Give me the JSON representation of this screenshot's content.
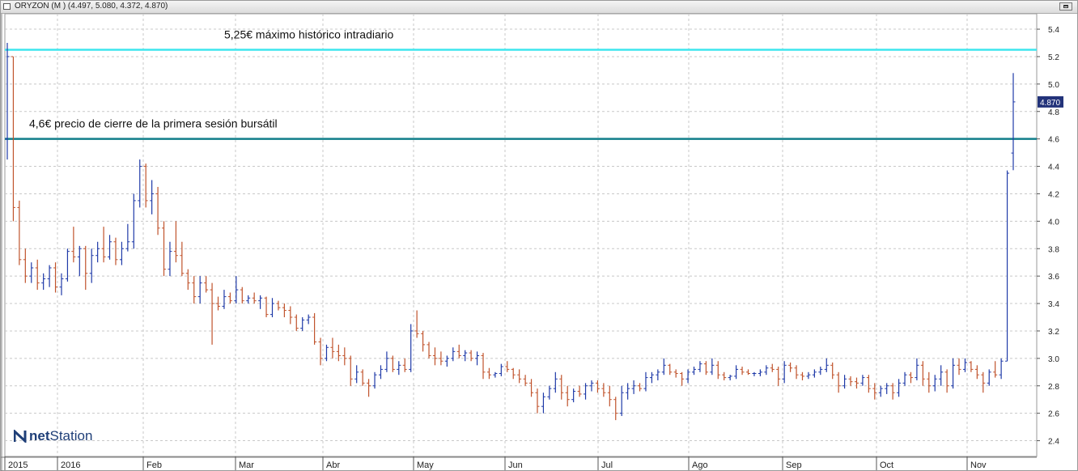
{
  "window": {
    "title": "ORYZON (M ) (4.497, 5.080, 4.372, 4.870)",
    "maximize_icon": "maximize-icon"
  },
  "logo": {
    "icon": "netstation-logo-icon",
    "text_prefix": "net",
    "text_main": "Station"
  },
  "chart_data": {
    "type": "ohlc",
    "grid": true,
    "ylim": [
      2.3,
      5.45
    ],
    "y_ticks": [
      2.4,
      2.6,
      2.8,
      3.0,
      3.2,
      3.4,
      3.6,
      3.8,
      4.0,
      4.2,
      4.4,
      4.6,
      4.8,
      5.0,
      5.2,
      5.4
    ],
    "x_labels": [
      "2015",
      "2016",
      "Feb",
      "Mar",
      "Abr",
      "May",
      "Jun",
      "Jul",
      "Ago",
      "Sep",
      "Oct",
      "Nov"
    ],
    "last_price": {
      "value": 4.87,
      "label": "4.870"
    },
    "colors": {
      "up": "#1f3aa8",
      "down": "#c0532c",
      "resistance": "#3ee6ee",
      "support": "#117e8a",
      "last_price_bg": "#23337a"
    },
    "hlines": [
      {
        "value": 5.25,
        "label": "5,25€ máximo histórico intradiario",
        "style": "resistance"
      },
      {
        "value": 4.6,
        "label": "4,6€ precio de cierre de la primera sesión bursátil",
        "style": "support"
      }
    ],
    "bars": [
      [
        4.6,
        5.3,
        4.45,
        5.2
      ],
      [
        5.2,
        5.2,
        4.0,
        4.1
      ],
      [
        4.1,
        4.15,
        3.68,
        3.72
      ],
      [
        3.72,
        3.8,
        3.55,
        3.6
      ],
      [
        3.6,
        3.7,
        3.55,
        3.66
      ],
      [
        3.66,
        3.72,
        3.5,
        3.55
      ],
      [
        3.55,
        3.62,
        3.5,
        3.58
      ],
      [
        3.58,
        3.68,
        3.52,
        3.66
      ],
      [
        3.66,
        3.7,
        3.48,
        3.52
      ],
      [
        3.52,
        3.62,
        3.46,
        3.58
      ],
      [
        3.58,
        3.8,
        3.56,
        3.78
      ],
      [
        3.78,
        3.96,
        3.7,
        3.74
      ],
      [
        3.74,
        3.82,
        3.6,
        3.8
      ],
      [
        3.8,
        3.82,
        3.5,
        3.62
      ],
      [
        3.62,
        3.8,
        3.55,
        3.75
      ],
      [
        3.75,
        3.85,
        3.7,
        3.8
      ],
      [
        3.8,
        3.96,
        3.7,
        3.74
      ],
      [
        3.74,
        3.9,
        3.72,
        3.85
      ],
      [
        3.85,
        3.88,
        3.68,
        3.72
      ],
      [
        3.72,
        3.85,
        3.68,
        3.8
      ],
      [
        3.8,
        3.98,
        3.78,
        3.85
      ],
      [
        3.85,
        4.2,
        3.8,
        4.15
      ],
      [
        4.15,
        4.45,
        4.1,
        4.4
      ],
      [
        4.4,
        4.42,
        4.1,
        4.15
      ],
      [
        4.15,
        4.3,
        4.05,
        4.2
      ],
      [
        4.2,
        4.25,
        3.9,
        3.95
      ],
      [
        3.95,
        4.0,
        3.6,
        3.65
      ],
      [
        3.65,
        3.85,
        3.6,
        3.78
      ],
      [
        3.78,
        4.0,
        3.7,
        3.75
      ],
      [
        3.75,
        3.85,
        3.6,
        3.62
      ],
      [
        3.62,
        3.65,
        3.5,
        3.55
      ],
      [
        3.55,
        3.6,
        3.4,
        3.45
      ],
      [
        3.45,
        3.6,
        3.4,
        3.55
      ],
      [
        3.55,
        3.6,
        3.48,
        3.5
      ],
      [
        3.5,
        3.55,
        3.1,
        3.4
      ],
      [
        3.4,
        3.45,
        3.35,
        3.38
      ],
      [
        3.38,
        3.5,
        3.36,
        3.45
      ],
      [
        3.45,
        3.48,
        3.4,
        3.42
      ],
      [
        3.42,
        3.6,
        3.4,
        3.5
      ],
      [
        3.5,
        3.52,
        3.4,
        3.42
      ],
      [
        3.42,
        3.46,
        3.4,
        3.44
      ],
      [
        3.44,
        3.48,
        3.4,
        3.42
      ],
      [
        3.42,
        3.46,
        3.36,
        3.44
      ],
      [
        3.44,
        3.45,
        3.3,
        3.32
      ],
      [
        3.32,
        3.44,
        3.3,
        3.4
      ],
      [
        3.4,
        3.42,
        3.35,
        3.37
      ],
      [
        3.37,
        3.4,
        3.3,
        3.35
      ],
      [
        3.35,
        3.38,
        3.25,
        3.3
      ],
      [
        3.3,
        3.32,
        3.2,
        3.22
      ],
      [
        3.22,
        3.3,
        3.2,
        3.28
      ],
      [
        3.28,
        3.32,
        3.25,
        3.3
      ],
      [
        3.3,
        3.33,
        3.1,
        3.12
      ],
      [
        3.12,
        3.15,
        2.95,
        3.0
      ],
      [
        3.0,
        3.1,
        2.98,
        3.08
      ],
      [
        3.08,
        3.15,
        3.0,
        3.05
      ],
      [
        3.05,
        3.1,
        2.98,
        3.02
      ],
      [
        3.02,
        3.08,
        2.95,
        3.0
      ],
      [
        3.0,
        3.02,
        2.8,
        2.85
      ],
      [
        2.85,
        2.95,
        2.82,
        2.9
      ],
      [
        2.9,
        2.92,
        2.8,
        2.82
      ],
      [
        2.82,
        2.85,
        2.72,
        2.8
      ],
      [
        2.8,
        2.9,
        2.78,
        2.88
      ],
      [
        2.88,
        2.95,
        2.85,
        2.92
      ],
      [
        2.92,
        3.05,
        2.9,
        3.0
      ],
      [
        3.0,
        3.02,
        2.9,
        2.92
      ],
      [
        2.92,
        2.98,
        2.88,
        2.95
      ],
      [
        2.95,
        3.0,
        2.9,
        2.92
      ],
      [
        2.92,
        3.25,
        2.9,
        3.2
      ],
      [
        3.2,
        3.35,
        3.15,
        3.18
      ],
      [
        3.18,
        3.2,
        3.05,
        3.1
      ],
      [
        3.1,
        3.12,
        3.0,
        3.02
      ],
      [
        3.02,
        3.08,
        2.95,
        3.0
      ],
      [
        3.0,
        3.05,
        2.95,
        2.98
      ],
      [
        2.98,
        3.02,
        2.94,
        3.0
      ],
      [
        3.0,
        3.08,
        2.98,
        3.05
      ],
      [
        3.05,
        3.1,
        3.0,
        3.02
      ],
      [
        3.02,
        3.06,
        2.98,
        3.04
      ],
      [
        3.04,
        3.06,
        2.98,
        3.0
      ],
      [
        3.0,
        3.05,
        2.95,
        3.02
      ],
      [
        3.02,
        3.04,
        2.85,
        2.9
      ],
      [
        2.9,
        2.93,
        2.85,
        2.88
      ],
      [
        2.88,
        2.9,
        2.86,
        2.89
      ],
      [
        2.89,
        2.96,
        2.87,
        2.94
      ],
      [
        2.94,
        2.98,
        2.9,
        2.92
      ],
      [
        2.92,
        2.93,
        2.85,
        2.88
      ],
      [
        2.88,
        2.92,
        2.82,
        2.85
      ],
      [
        2.85,
        2.88,
        2.8,
        2.82
      ],
      [
        2.82,
        2.85,
        2.72,
        2.75
      ],
      [
        2.75,
        2.78,
        2.6,
        2.65
      ],
      [
        2.65,
        2.75,
        2.6,
        2.72
      ],
      [
        2.72,
        2.8,
        2.7,
        2.78
      ],
      [
        2.78,
        2.9,
        2.75,
        2.85
      ],
      [
        2.85,
        2.88,
        2.7,
        2.75
      ],
      [
        2.75,
        2.8,
        2.65,
        2.7
      ],
      [
        2.7,
        2.78,
        2.68,
        2.76
      ],
      [
        2.76,
        2.8,
        2.72,
        2.74
      ],
      [
        2.74,
        2.82,
        2.7,
        2.8
      ],
      [
        2.8,
        2.84,
        2.76,
        2.82
      ],
      [
        2.82,
        2.84,
        2.75,
        2.78
      ],
      [
        2.78,
        2.82,
        2.72,
        2.75
      ],
      [
        2.75,
        2.8,
        2.65,
        2.7
      ],
      [
        2.7,
        2.72,
        2.55,
        2.6
      ],
      [
        2.6,
        2.8,
        2.58,
        2.75
      ],
      [
        2.75,
        2.82,
        2.7,
        2.78
      ],
      [
        2.78,
        2.84,
        2.74,
        2.8
      ],
      [
        2.8,
        2.82,
        2.76,
        2.78
      ],
      [
        2.78,
        2.9,
        2.76,
        2.86
      ],
      [
        2.86,
        2.9,
        2.82,
        2.88
      ],
      [
        2.88,
        2.92,
        2.84,
        2.9
      ],
      [
        2.9,
        3.0,
        2.88,
        2.95
      ],
      [
        2.95,
        2.96,
        2.88,
        2.9
      ],
      [
        2.9,
        2.92,
        2.86,
        2.89
      ],
      [
        2.89,
        2.9,
        2.8,
        2.85
      ],
      [
        2.85,
        2.92,
        2.82,
        2.9
      ],
      [
        2.9,
        2.94,
        2.88,
        2.92
      ],
      [
        2.92,
        2.98,
        2.9,
        2.96
      ],
      [
        2.96,
        2.98,
        2.88,
        2.9
      ],
      [
        2.9,
        3.0,
        2.88,
        2.95
      ],
      [
        2.95,
        2.98,
        2.85,
        2.88
      ],
      [
        2.88,
        2.9,
        2.84,
        2.86
      ],
      [
        2.86,
        2.88,
        2.84,
        2.87
      ],
      [
        2.87,
        2.95,
        2.85,
        2.92
      ],
      [
        2.92,
        2.94,
        2.88,
        2.9
      ],
      [
        2.9,
        2.92,
        2.88,
        2.89
      ],
      [
        2.89,
        2.9,
        2.87,
        2.89
      ],
      [
        2.89,
        2.92,
        2.87,
        2.9
      ],
      [
        2.9,
        2.95,
        2.88,
        2.93
      ],
      [
        2.93,
        2.96,
        2.9,
        2.92
      ],
      [
        2.92,
        2.94,
        2.8,
        2.85
      ],
      [
        2.85,
        2.98,
        2.82,
        2.95
      ],
      [
        2.95,
        2.97,
        2.9,
        2.93
      ],
      [
        2.93,
        2.95,
        2.85,
        2.88
      ],
      [
        2.88,
        2.9,
        2.84,
        2.87
      ],
      [
        2.87,
        2.9,
        2.85,
        2.88
      ],
      [
        2.88,
        2.92,
        2.86,
        2.9
      ],
      [
        2.9,
        2.94,
        2.88,
        2.92
      ],
      [
        2.92,
        3.0,
        2.9,
        2.95
      ],
      [
        2.95,
        2.97,
        2.85,
        2.88
      ],
      [
        2.88,
        2.9,
        2.75,
        2.8
      ],
      [
        2.8,
        2.88,
        2.78,
        2.85
      ],
      [
        2.85,
        2.87,
        2.8,
        2.83
      ],
      [
        2.83,
        2.86,
        2.78,
        2.82
      ],
      [
        2.82,
        2.88,
        2.8,
        2.86
      ],
      [
        2.86,
        2.88,
        2.75,
        2.78
      ],
      [
        2.78,
        2.82,
        2.7,
        2.75
      ],
      [
        2.75,
        2.8,
        2.72,
        2.78
      ],
      [
        2.78,
        2.82,
        2.74,
        2.8
      ],
      [
        2.8,
        2.82,
        2.7,
        2.75
      ],
      [
        2.75,
        2.85,
        2.72,
        2.82
      ],
      [
        2.82,
        2.9,
        2.8,
        2.88
      ],
      [
        2.88,
        2.9,
        2.82,
        2.86
      ],
      [
        2.86,
        3.0,
        2.84,
        2.95
      ],
      [
        2.95,
        2.98,
        2.8,
        2.85
      ],
      [
        2.85,
        2.9,
        2.75,
        2.8
      ],
      [
        2.8,
        2.88,
        2.76,
        2.85
      ],
      [
        2.85,
        2.95,
        2.8,
        2.9
      ],
      [
        2.9,
        2.92,
        2.75,
        2.8
      ],
      [
        2.8,
        3.0,
        2.78,
        2.95
      ],
      [
        2.95,
        3.0,
        2.88,
        2.92
      ],
      [
        2.92,
        3.0,
        2.9,
        2.97
      ],
      [
        2.97,
        2.98,
        2.9,
        2.92
      ],
      [
        2.92,
        2.95,
        2.85,
        2.88
      ],
      [
        2.88,
        2.9,
        2.75,
        2.82
      ],
      [
        2.82,
        2.92,
        2.8,
        2.9
      ],
      [
        2.9,
        2.98,
        2.86,
        2.88
      ],
      [
        2.88,
        3.0,
        2.85,
        2.98
      ],
      [
        2.98,
        4.37,
        2.98,
        4.35
      ],
      [
        4.497,
        5.08,
        4.372,
        4.87
      ]
    ]
  }
}
